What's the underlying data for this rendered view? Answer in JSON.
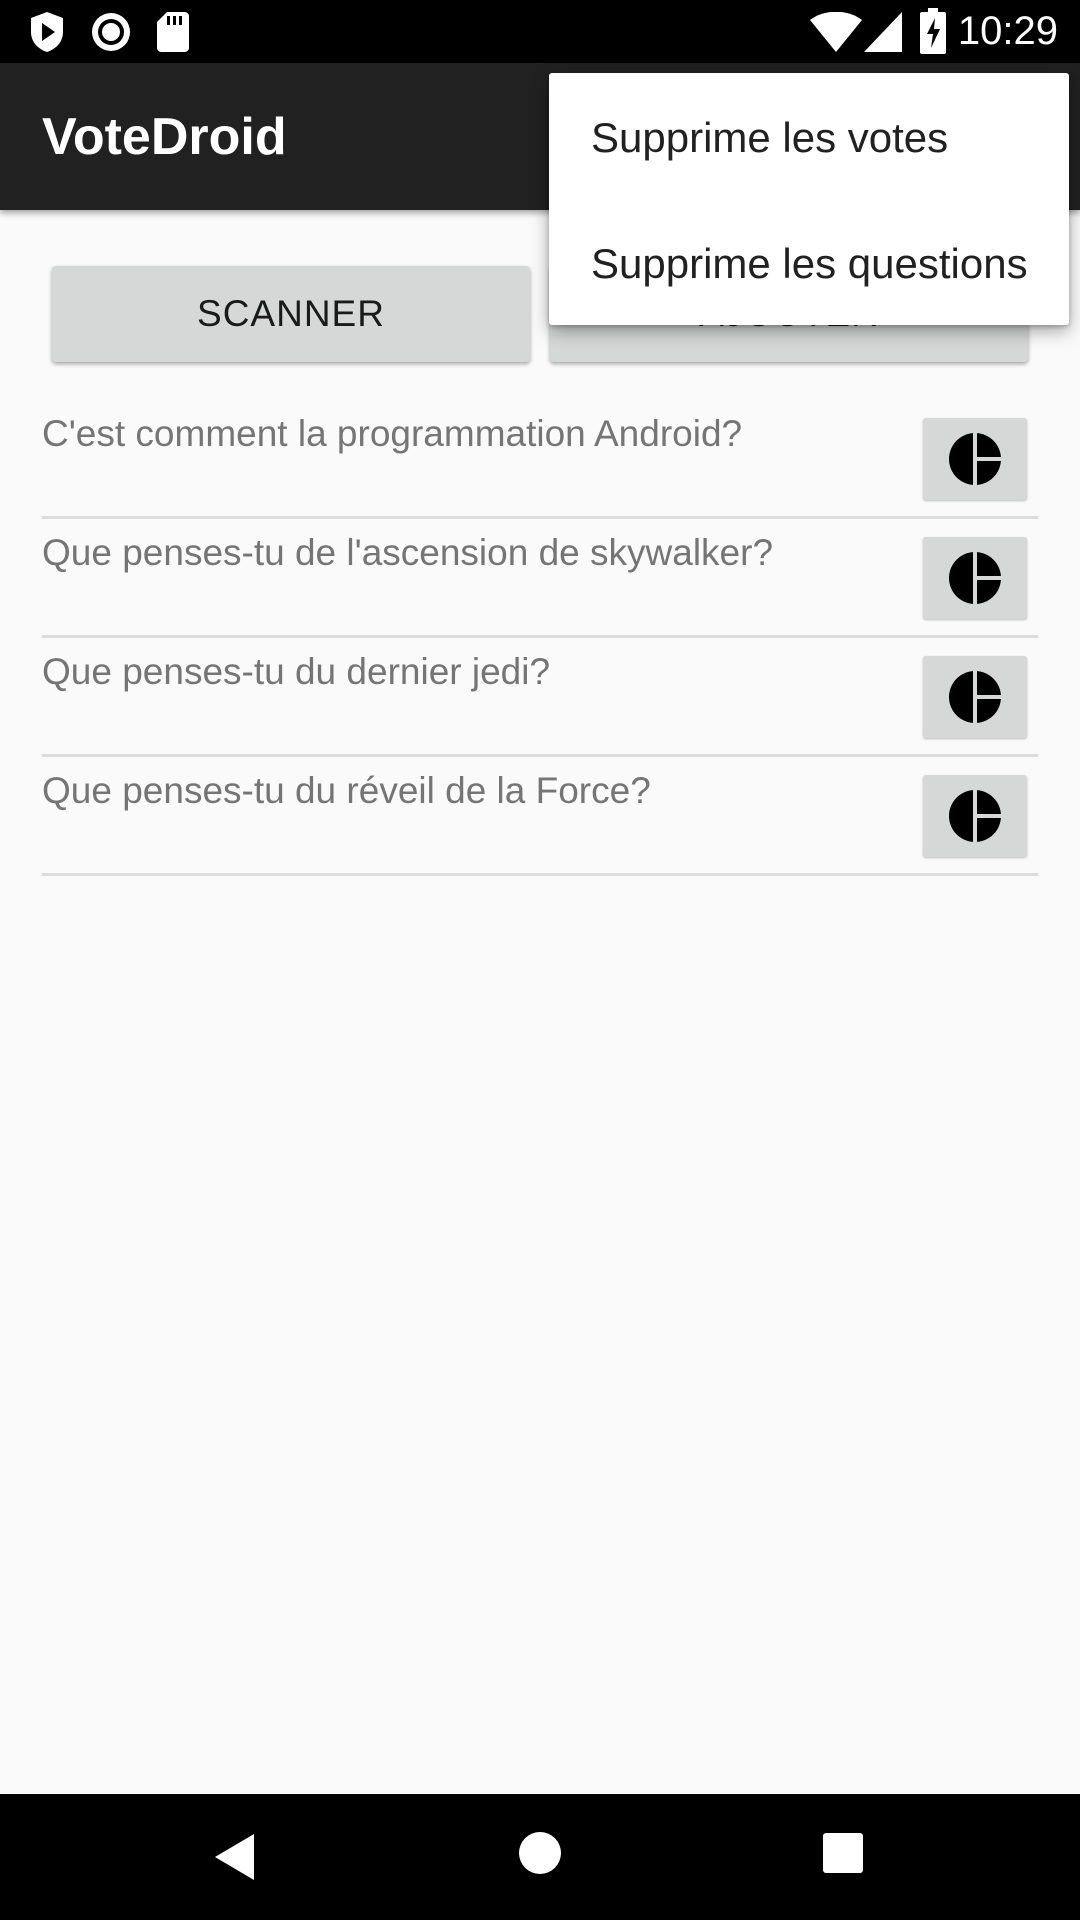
{
  "status_bar": {
    "time": "10:29",
    "icons": [
      "shield-play-icon",
      "record-icon",
      "sd-card-icon",
      "wifi-icon",
      "signal-icon",
      "battery-charging-icon"
    ]
  },
  "app_bar": {
    "title": "VoteDroid",
    "background": "#212121"
  },
  "buttons": {
    "scan_label": "SCANNER",
    "add_label": "AJOUTER"
  },
  "questions": [
    {
      "text": "C'est comment la programmation Android?",
      "icon": "pie-chart-icon"
    },
    {
      "text": "Que penses-tu de l'ascension de skywalker?",
      "icon": "pie-chart-icon"
    },
    {
      "text": "Que penses-tu du dernier jedi?",
      "icon": "pie-chart-icon"
    },
    {
      "text": "Que penses-tu du réveil de la Force?",
      "icon": "pie-chart-icon"
    }
  ],
  "overflow_menu": {
    "items": [
      "Supprime les votes",
      "Supprime les questions"
    ]
  },
  "nav_bar": {
    "icons": [
      "back-icon",
      "home-icon",
      "recents-icon"
    ]
  },
  "colors": {
    "background": "#fafafa",
    "button": "#d6d7d7",
    "question_text": "#757575",
    "divider": "#dcdcdc"
  }
}
